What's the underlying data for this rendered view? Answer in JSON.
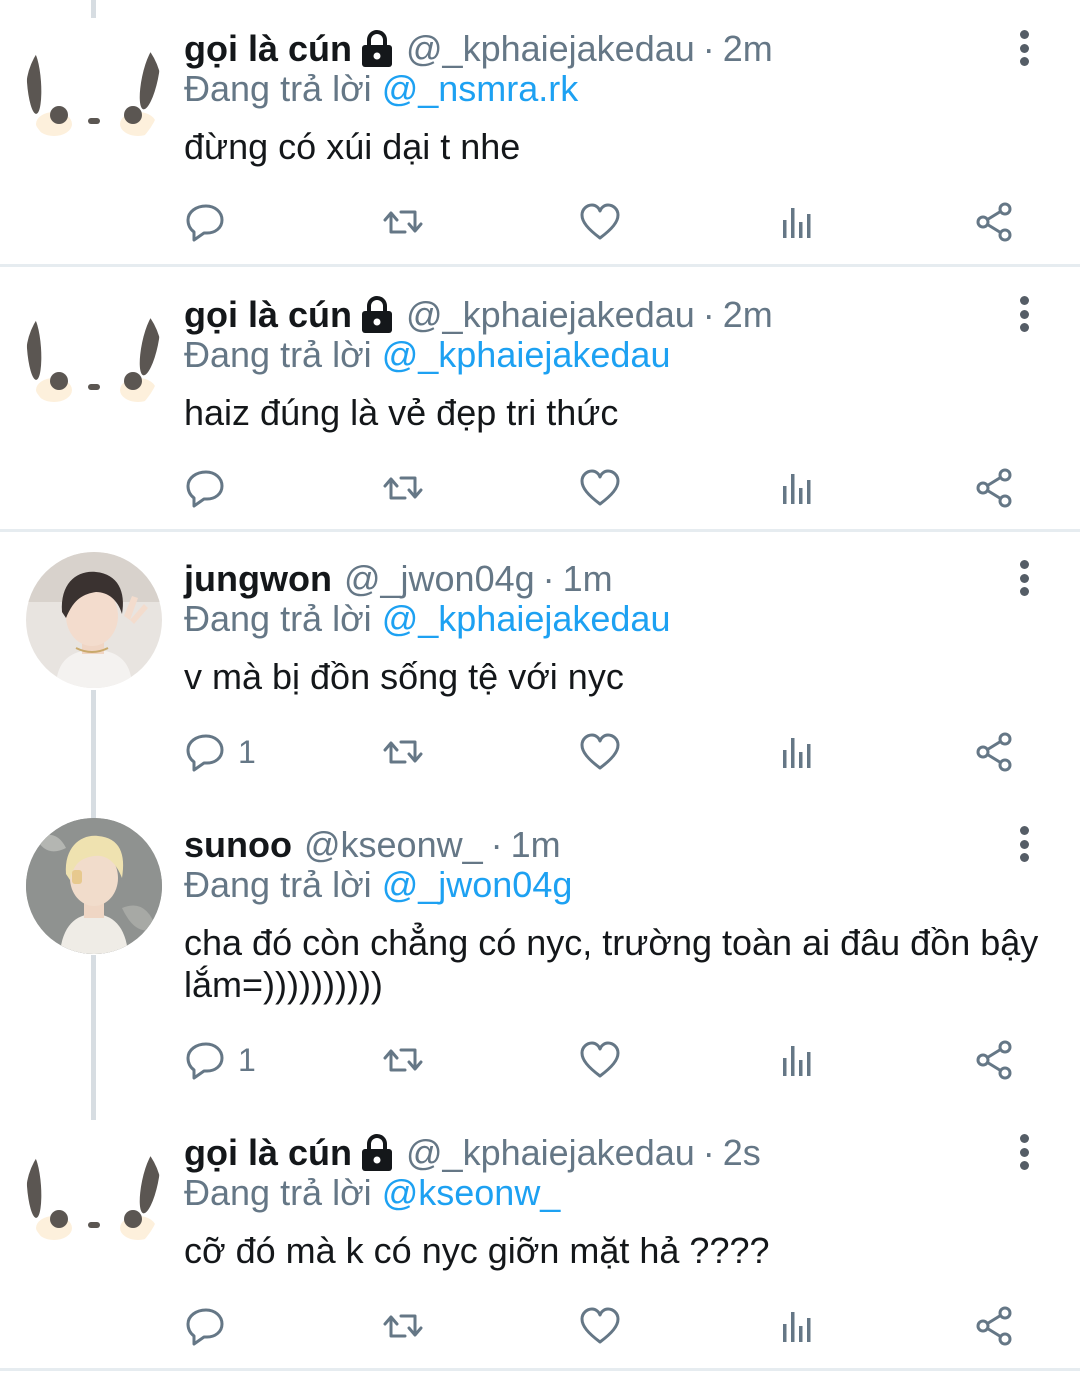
{
  "tweets": [
    {
      "name": "gọi là cún",
      "handle": "@_kphaiejakedau",
      "time": "2m",
      "reply_prefix": "Đang trả lời",
      "reply_to": "@_nsmra.rk",
      "text": "đừng có xúi dại t nhe",
      "reply_count": "",
      "avatar": "ghost-face"
    },
    {
      "name": "gọi là cún",
      "handle": "@_kphaiejakedau",
      "time": "2m",
      "reply_prefix": "Đang trả lời",
      "reply_to": "@_kphaiejakedau",
      "text": "haiz đúng là vẻ đẹp tri thức",
      "reply_count": "",
      "avatar": "ghost-face"
    },
    {
      "name": "jungwon",
      "handle": "@_jwon04g",
      "time": "1m",
      "reply_prefix": "Đang trả lời",
      "reply_to": "@_kphaiejakedau",
      "text": "v mà bị đồn sống tệ với nyc",
      "reply_count": "1",
      "avatar": "photo-dark-hair"
    },
    {
      "name": "sunoo",
      "handle": "@kseonw_",
      "time": "1m",
      "reply_prefix": "Đang trả lời",
      "reply_to": "@_jwon04g",
      "text": "cha đó còn chẳng có nyc, trường toàn ai đâu đồn bậy lắm=))))))))))",
      "reply_count": "1",
      "avatar": "photo-blonde-hair"
    },
    {
      "name": "gọi là cún",
      "handle": "@_kphaiejakedau",
      "time": "2s",
      "reply_prefix": "Đang trả lời",
      "reply_to": "@kseonw_",
      "text": "cỡ đó mà k có nyc giỡn mặt hả ????",
      "reply_count": "",
      "avatar": "ghost-face"
    }
  ],
  "icons": [
    "reply-icon",
    "retweet-icon",
    "like-icon",
    "analytics-icon",
    "share-icon",
    "more-options-icon",
    "lock-icon"
  ],
  "colors": {
    "text": "#14171a",
    "muted": "#657786",
    "link": "#1da1f2",
    "divider": "#e6ecf0"
  }
}
